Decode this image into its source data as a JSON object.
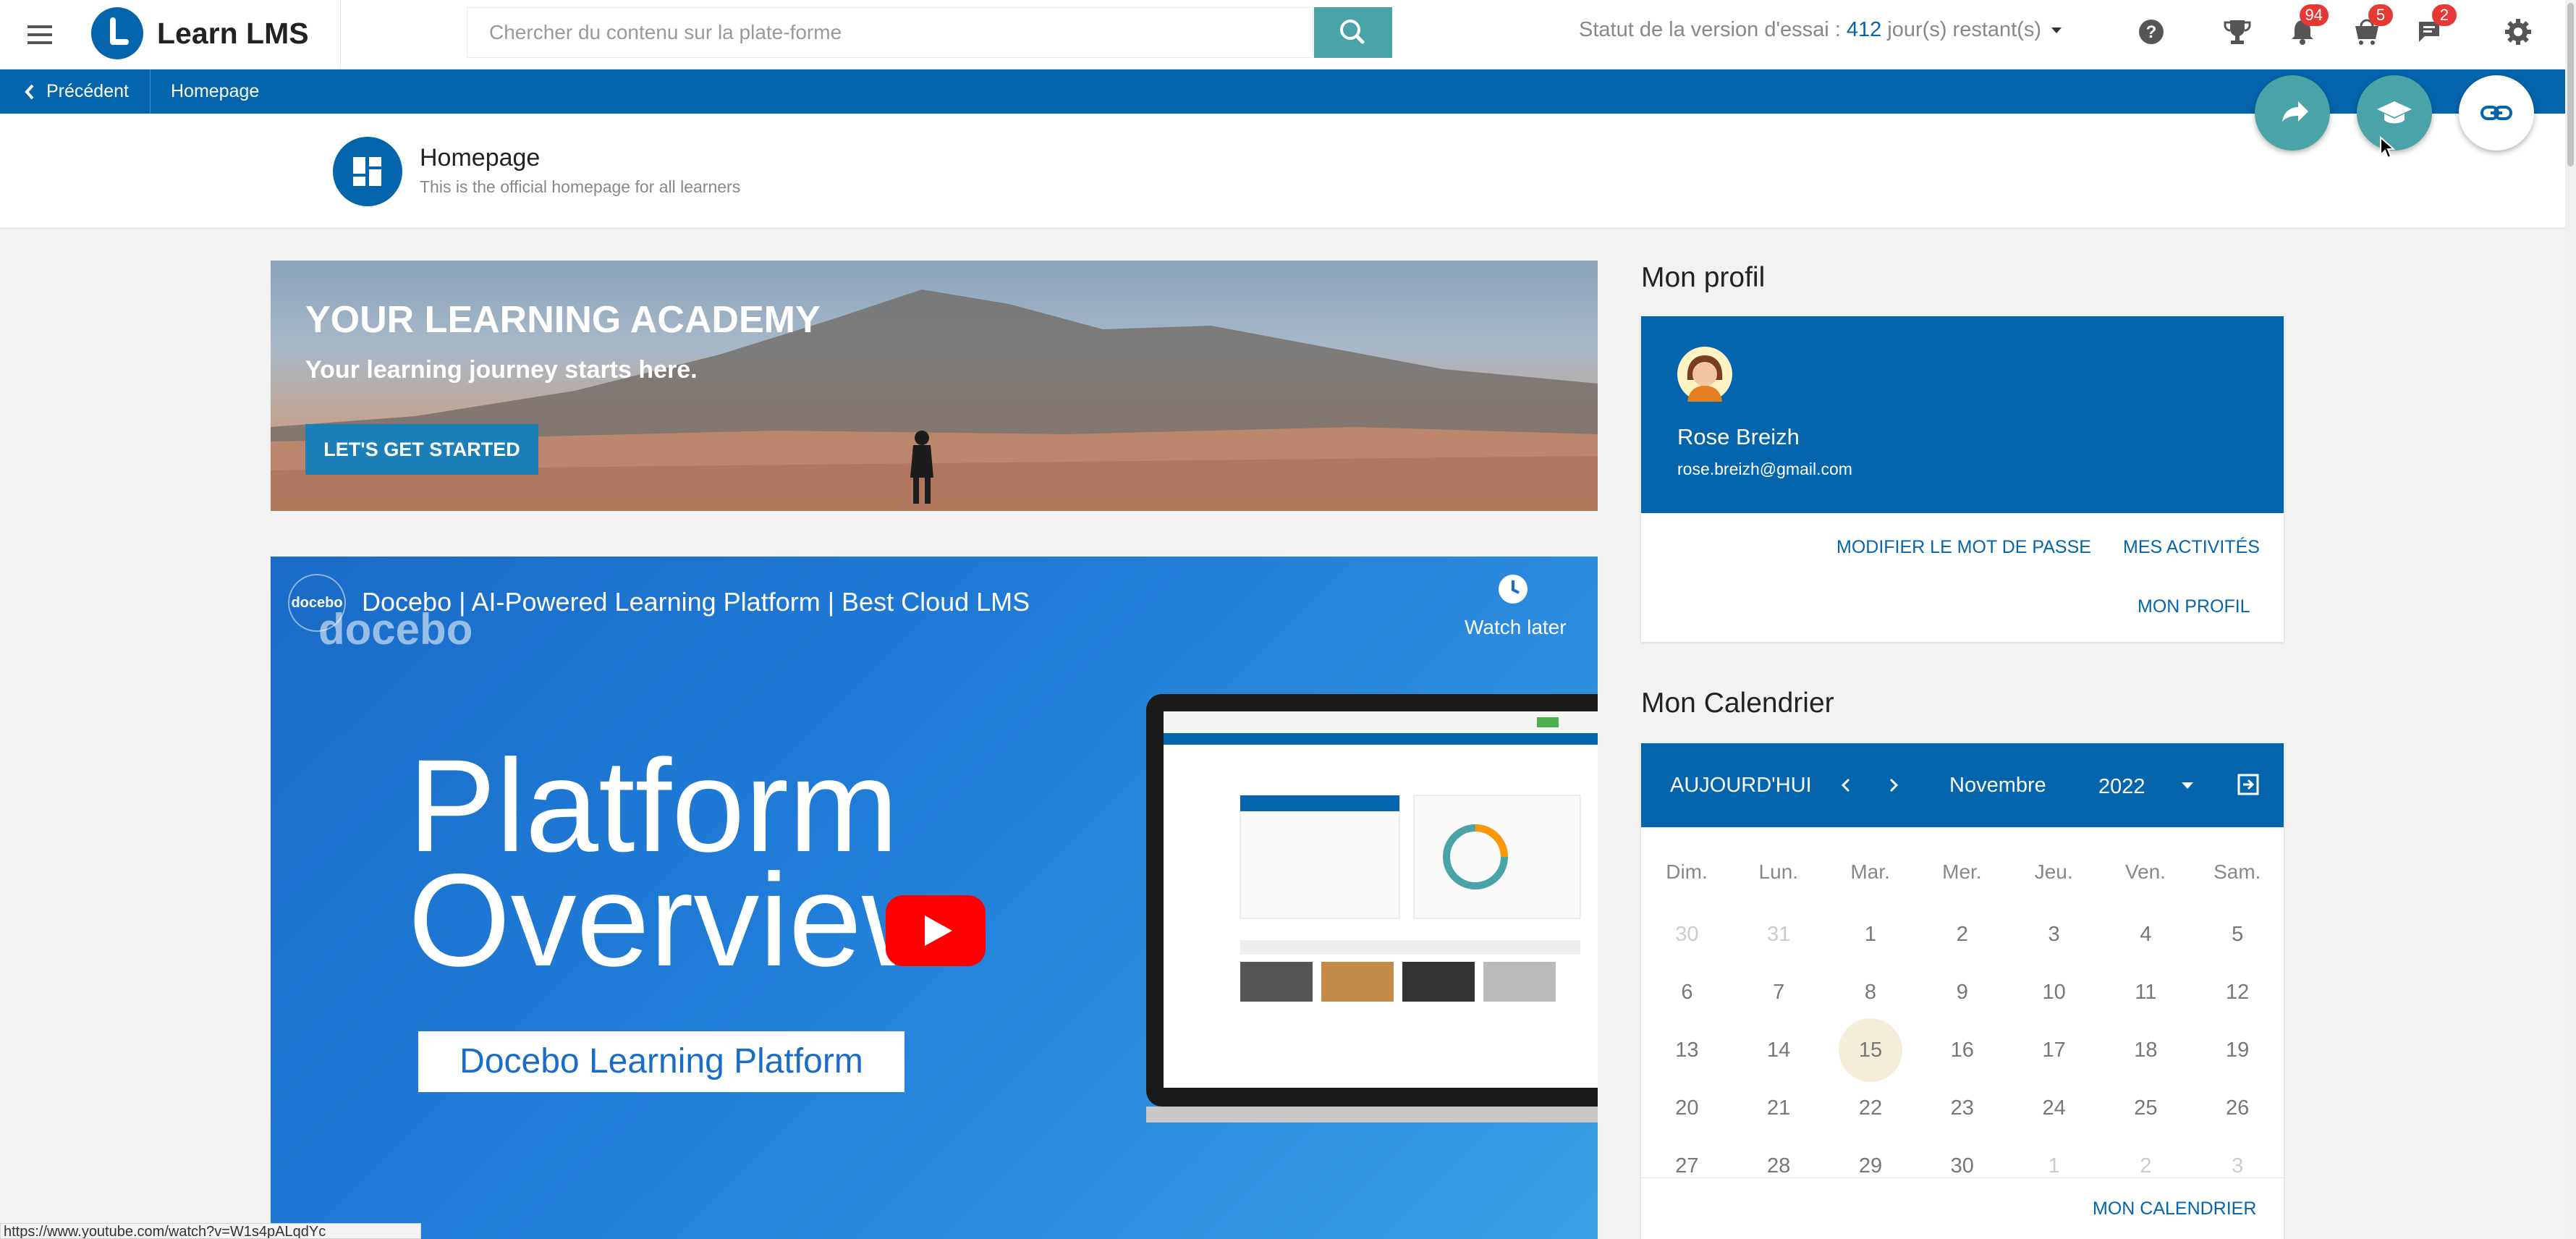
{
  "header": {
    "app_name": "Learn LMS",
    "search_placeholder": "Chercher du contenu sur la plate-forme",
    "trial_prefix": "Statut de la version d'essai : ",
    "trial_days": "412",
    "trial_suffix": " jour(s) restant(s)",
    "notifications_count": "94",
    "cart_count": "5",
    "messages_count": "2"
  },
  "nav": {
    "back_label": "Précédent",
    "breadcrumb": "Homepage"
  },
  "page": {
    "title": "Homepage",
    "subtitle": "This is the official homepage for all learners"
  },
  "banner": {
    "title": "YOUR LEARNING ACADEMY",
    "subtitle": "Your learning journey starts here.",
    "button_label": "LET'S GET STARTED"
  },
  "video": {
    "channel_avatar": "docebo",
    "title": "Docebo | AI-Powered Learning Platform | Best Cloud LMS",
    "brand": "docebo",
    "watch_later": "Watch later",
    "big_line1": "Platform",
    "big_line2": "Overview",
    "box_text": "Docebo Learning Platform"
  },
  "status_url": "https://www.youtube.com/watch?v=W1s4pALqdYc",
  "profile": {
    "section_title": "Mon profil",
    "name": "Rose Breizh",
    "email": "rose.breizh@gmail.com",
    "change_password": "MODIFIER LE MOT DE PASSE",
    "my_activities": "MES ACTIVITÉS",
    "my_profile": "MON PROFIL"
  },
  "calendar": {
    "section_title": "Mon Calendrier",
    "today_label": "AUJOURD'HUI",
    "month": "Novembre",
    "year": "2022",
    "weekdays": [
      "Dim.",
      "Lun.",
      "Mar.",
      "Mer.",
      "Jeu.",
      "Ven.",
      "Sam."
    ],
    "weeks": [
      [
        "30",
        "31",
        "1",
        "2",
        "3",
        "4",
        "5"
      ],
      [
        "6",
        "7",
        "8",
        "9",
        "10",
        "11",
        "12"
      ],
      [
        "13",
        "14",
        "15",
        "16",
        "17",
        "18",
        "19"
      ],
      [
        "20",
        "21",
        "22",
        "23",
        "24",
        "25",
        "26"
      ],
      [
        "27",
        "28",
        "29",
        "30",
        "1",
        "2",
        "3"
      ]
    ],
    "today": "15",
    "footer_link": "MON CALENDRIER"
  },
  "colors": {
    "primary": "#0465ac",
    "accent": "#4aa3a7",
    "badge": "#e53935"
  },
  "icons": [
    "menu-icon",
    "search-icon",
    "help-icon",
    "trophy-icon",
    "bell-icon",
    "cart-icon",
    "chat-icon",
    "gear-icon",
    "share-icon",
    "graduation-cap-icon",
    "link-icon",
    "clock-icon",
    "play-icon"
  ]
}
